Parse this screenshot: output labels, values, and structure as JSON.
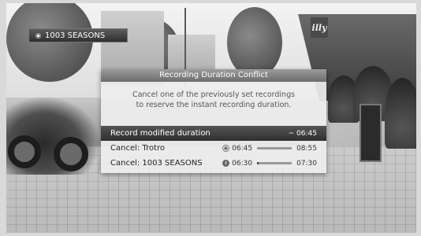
{
  "channel_banner": {
    "icon": "record-dot-icon",
    "name": "1003 SEASONS"
  },
  "background_sign": "illy",
  "dialog": {
    "title": "Recording Duration Conflict",
    "message_line1": "Cancel one of the previously set recordings",
    "message_line2": "to reserve the instant recording duration.",
    "options": [
      {
        "label": "Record modified duration",
        "time_right": "~ 06:45",
        "selected": true
      },
      {
        "label": "Cancel: Trotro",
        "icon": "recording-ring-icon",
        "start": "06:45",
        "end": "08:55",
        "progress": 0.0
      },
      {
        "label": "Cancel: 1003 SEASONS",
        "icon": "clock-icon",
        "start": "06:30",
        "end": "07:30",
        "progress": 0.05
      }
    ]
  }
}
